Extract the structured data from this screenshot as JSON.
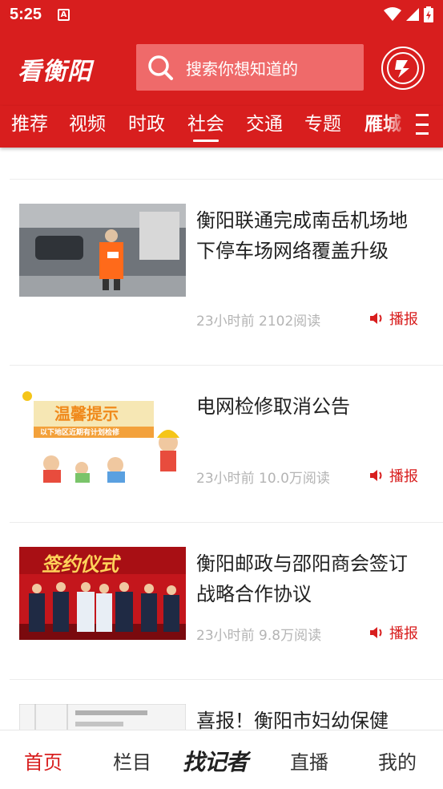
{
  "status": {
    "time": "5:25",
    "a_label": "A"
  },
  "header": {
    "logo": "看衡阳",
    "search_placeholder": "搜索你想知道的"
  },
  "tabs": [
    {
      "label": "推荐"
    },
    {
      "label": "视频"
    },
    {
      "label": "时政"
    },
    {
      "label": "社会"
    },
    {
      "label": "交通"
    },
    {
      "label": "专题"
    },
    {
      "label": "雁城"
    }
  ],
  "active_tab": "社会",
  "colors": {
    "brand_red": "#d81e1e",
    "search_bg": "#ef6a6a",
    "meta_gray": "#b4b4b4"
  },
  "feed": [
    {
      "title": "衡阳联通完成南岳机场地下停车场网络覆盖升级",
      "time": "23小时前",
      "reads": "2102阅读",
      "play": "播报",
      "thumb_text": ""
    },
    {
      "title": "电网检修取消公告",
      "time": "23小时前",
      "reads": "10.0万阅读",
      "play": "播报",
      "thumb_text": "温馨提示",
      "thumb_sub": "以下地区近期有计划检修"
    },
    {
      "title": "衡阳邮政与邵阳商会签订战略合作协议",
      "time": "23小时前",
      "reads": "9.8万阅读",
      "play": "播报",
      "thumb_text": "签约仪式"
    },
    {
      "title": "喜报！衡阳市妇幼保健",
      "time": "",
      "reads": "",
      "play": "",
      "thumb_text": ""
    }
  ],
  "bottom_nav": {
    "home": "首页",
    "columns": "栏目",
    "brand": "找记者",
    "live": "直播",
    "mine": "我的"
  }
}
